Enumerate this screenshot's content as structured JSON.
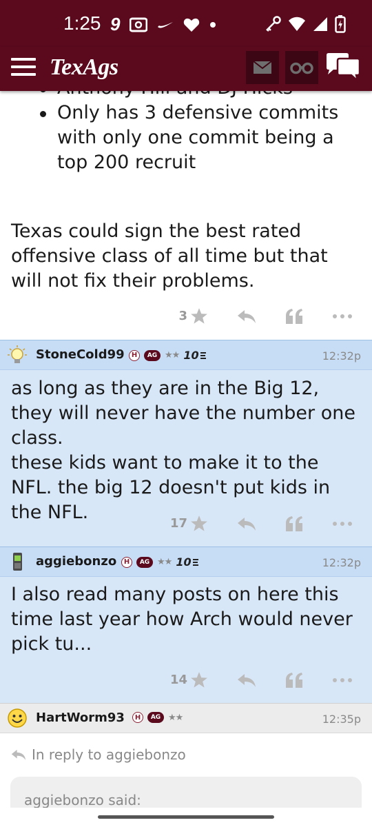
{
  "status_bar": {
    "time": "1:25",
    "left_icons": [
      "nine-icon",
      "radio-icon",
      "swoosh-icon",
      "heart-icon",
      "dot-icon"
    ],
    "right_icons": [
      "key-icon",
      "wifi-icon",
      "signal-icon",
      "battery-icon"
    ]
  },
  "header": {
    "logo": "TexAgs",
    "icons": [
      "menu-icon",
      "mail-icon",
      "binoculars-icon",
      "chat-icon"
    ]
  },
  "prev_post": {
    "bullets": [
      "Anthony Hill and DJ Hicks",
      "Only has 3 defensive commits with only one commit being a top 200 recruit"
    ],
    "paragraph": "Texas could sign the best rated offensive class of all time but that will not fix their problems.",
    "star_count": "3"
  },
  "posts": [
    {
      "username": "StoneCold99",
      "badge_h": "H",
      "badge_ag": "AG",
      "stars": "★★",
      "tenx": "10",
      "time": "12:32p",
      "avatar": "lightbulb-icon",
      "paragraphs": [
        "as long as they are in the Big 12, they will never have the number one class.",
        "these kids want to make it to the NFL. the big 12 doesn't put kids in the NFL."
      ],
      "star_count": "17"
    },
    {
      "username": "aggiebonzo",
      "badge_h": "H",
      "badge_ag": "AG",
      "stars": "★★",
      "tenx": "10",
      "time": "12:32p",
      "avatar": "phone-icon",
      "paragraphs": [
        "I also read many posts on here this time last year how Arch would never pick tu..."
      ],
      "star_count": "14"
    },
    {
      "username": "HartWorm93",
      "badge_h": "H",
      "badge_ag": "AG",
      "stars": "★★",
      "time": "12:35p",
      "avatar": "smiley-icon",
      "reply_to": "In reply to aggiebonzo",
      "quote_said": "aggiebonzo said:"
    }
  ],
  "colors": {
    "brand": "#5b0a1e",
    "post_bg_blue": "#d8e7f8",
    "post_header_blue": "#c7dcf5",
    "muted": "#999999"
  }
}
